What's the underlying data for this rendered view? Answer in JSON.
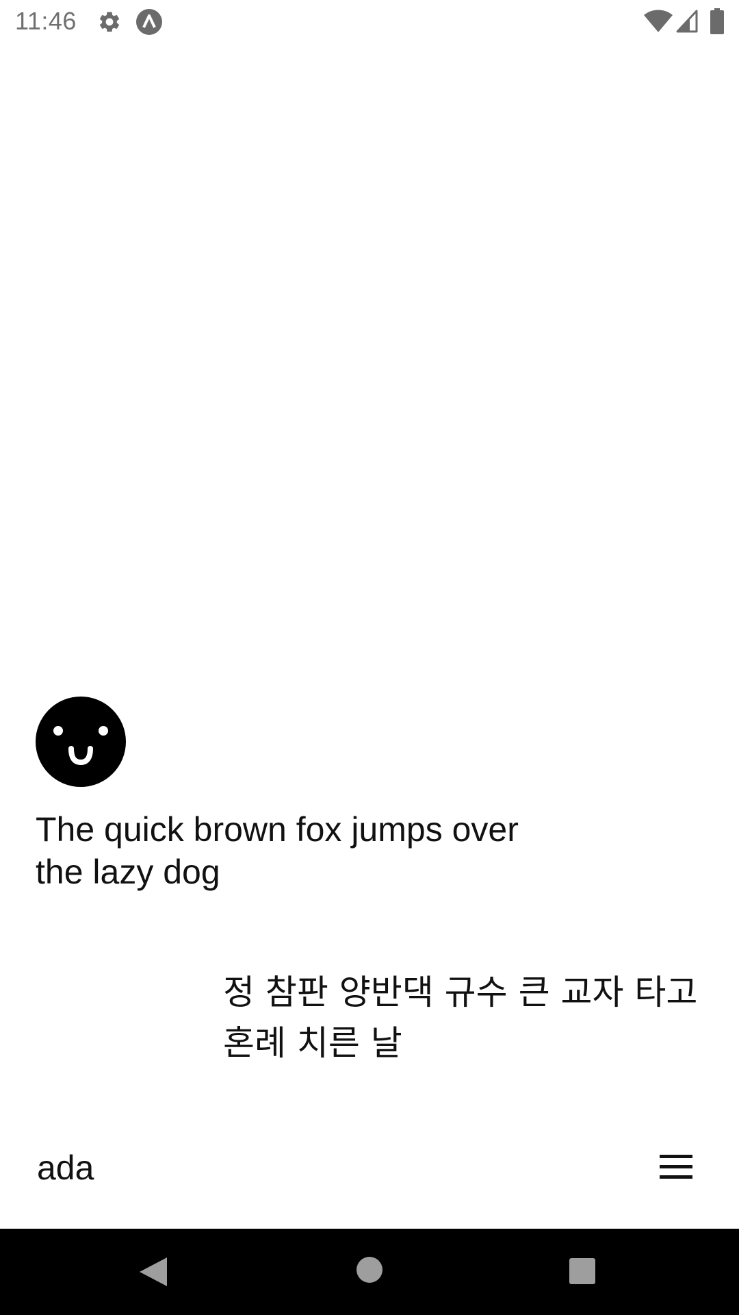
{
  "status_bar": {
    "time": "11:46",
    "icons": [
      "gear-icon",
      "alpha-app-icon",
      "wifi-icon",
      "cell-signal-icon",
      "battery-icon"
    ]
  },
  "main": {
    "avatar_icon": "smiley-face-icon",
    "english_text": "The quick brown fox jumps over the lazy dog",
    "korean_text": "정 참판 양반댁 규수 큰 교자 타고 혼례 치른 날"
  },
  "app_bar": {
    "app_name": "ada",
    "menu_icon": "hamburger-menu-icon"
  },
  "nav_bar": {
    "icons": [
      "back-icon",
      "home-icon",
      "recents-icon"
    ]
  },
  "colors": {
    "background": "#ffffff",
    "text": "#111111",
    "status_text": "#707070",
    "nav_background": "#000000",
    "nav_icons": "#9e9e9e"
  }
}
